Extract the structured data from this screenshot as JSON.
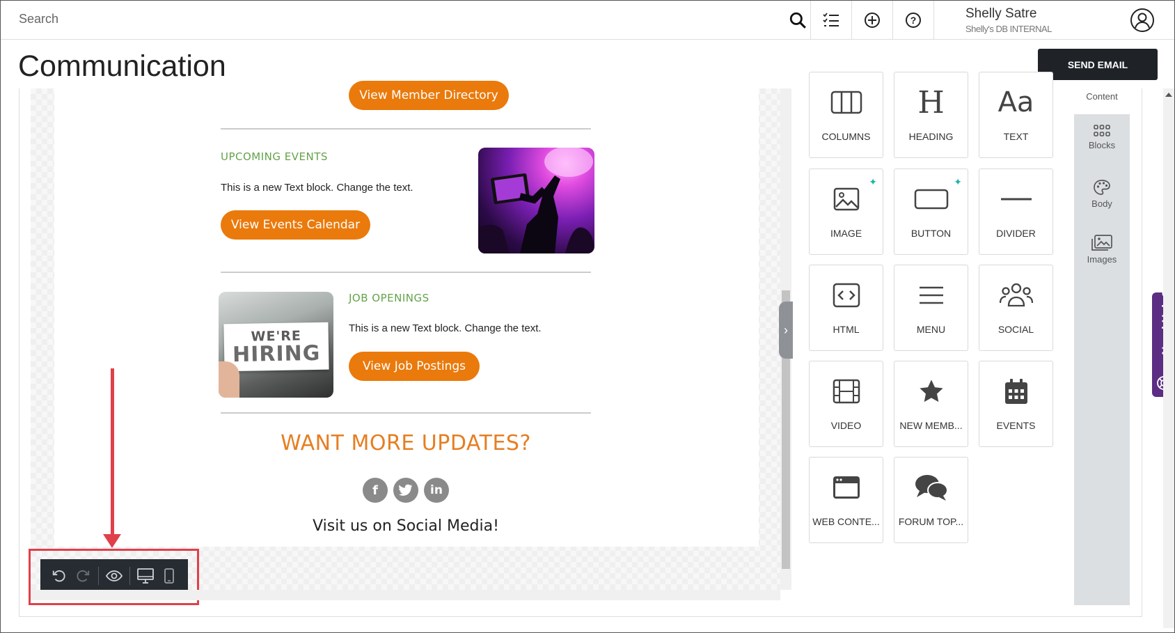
{
  "topbar": {
    "search_placeholder": "Search",
    "user_name": "Shelly Satre",
    "user_org": "Shelly's DB INTERNAL",
    "icons": [
      "search-icon",
      "checklist-icon",
      "plus-circle-icon",
      "help-circle-icon",
      "user-avatar-icon"
    ]
  },
  "header": {
    "title": "Communication",
    "send_email_label": "SEND EMAIL"
  },
  "email": {
    "directory_button": "View Member Directory",
    "events_heading": "UPCOMING EVENTS",
    "events_text": "This is a new Text block. Change the text.",
    "events_button": "View Events Calendar",
    "jobs_heading": "JOB OPENINGS",
    "jobs_text": "This is a new Text block. Change the text.",
    "jobs_button": "View Job Postings",
    "hiring_line1": "WE'RE",
    "hiring_line2": "HIRING",
    "updates_title": "WANT MORE UPDATES?",
    "social_text": "Visit us on Social Media!",
    "social_icons": [
      "facebook-icon",
      "twitter-icon",
      "linkedin-icon"
    ]
  },
  "toolbar": {
    "buttons": [
      "undo-icon",
      "redo-icon",
      "preview-eye-icon",
      "desktop-view-icon",
      "mobile-view-icon"
    ]
  },
  "blocks": [
    {
      "label": "COLUMNS",
      "icon": "columns-icon"
    },
    {
      "label": "HEADING",
      "icon": "heading-icon"
    },
    {
      "label": "TEXT",
      "icon": "text-icon"
    },
    {
      "label": "IMAGE",
      "icon": "image-icon"
    },
    {
      "label": "BUTTON",
      "icon": "button-icon"
    },
    {
      "label": "DIVIDER",
      "icon": "divider-icon"
    },
    {
      "label": "HTML",
      "icon": "html-icon"
    },
    {
      "label": "MENU",
      "icon": "menu-icon"
    },
    {
      "label": "SOCIAL",
      "icon": "social-icon"
    },
    {
      "label": "VIDEO",
      "icon": "video-icon"
    },
    {
      "label": "NEW MEMB...",
      "icon": "star-icon"
    },
    {
      "label": "EVENTS",
      "icon": "calendar-icon"
    },
    {
      "label": "WEB CONTE...",
      "icon": "web-content-icon"
    },
    {
      "label": "FORUM TOP...",
      "icon": "forum-icon"
    }
  ],
  "right_nav": {
    "content": "Content",
    "blocks": "Blocks",
    "body": "Body",
    "images": "Images"
  },
  "need_help": "Need Help?",
  "colors": {
    "accent_orange": "#ea7a0c",
    "heading_green": "#64a349",
    "dark_button": "#1f2328",
    "help_purple": "#5b2d83",
    "annotation_red": "#e0404a"
  }
}
